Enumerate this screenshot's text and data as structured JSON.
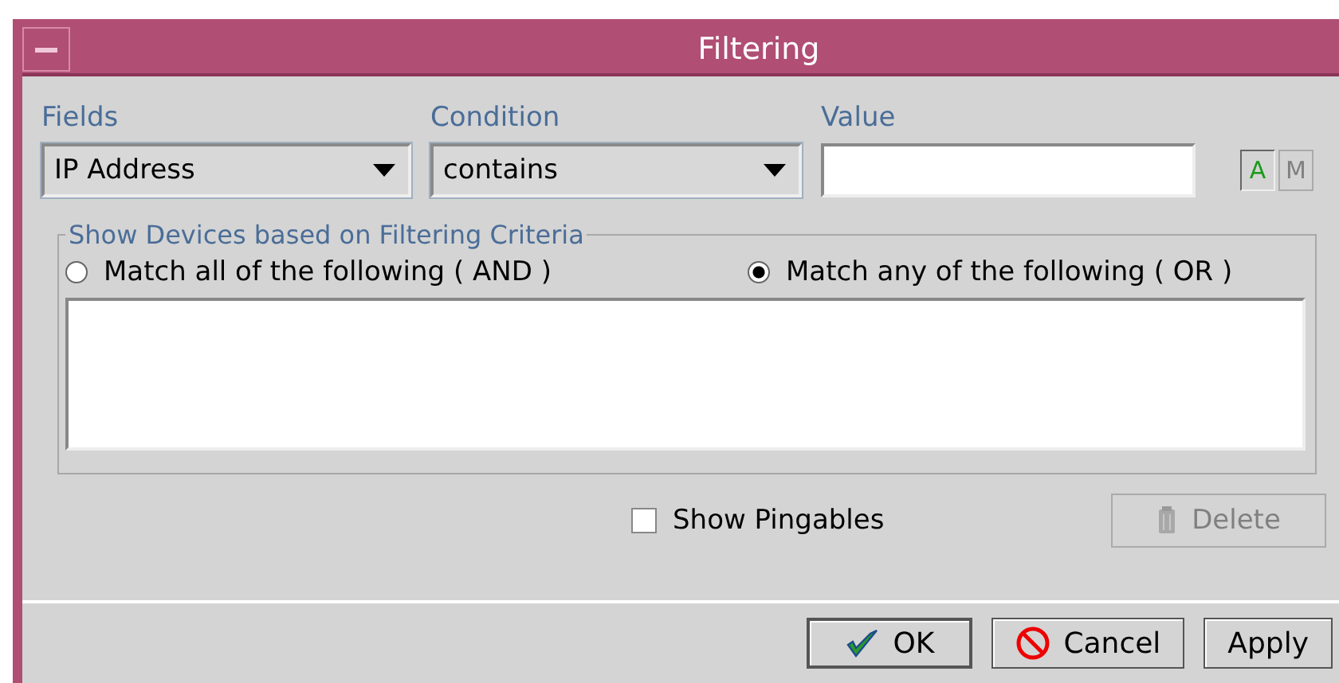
{
  "window": {
    "title": "Filtering"
  },
  "criteria": [
    {
      "kind": "select",
      "label": "Fields",
      "value": "IP Address"
    },
    {
      "kind": "select",
      "label": "Condition",
      "value": "contains"
    },
    {
      "kind": "input",
      "label": "Value"
    }
  ],
  "mode_buttons": [
    {
      "label": "A",
      "disabled": false
    },
    {
      "label": "M",
      "disabled": true
    }
  ],
  "group": {
    "legend": "Show Devices based on Filtering Criteria",
    "options": [
      {
        "label": "Match all of the following ( AND )",
        "selected": false
      },
      {
        "label": "Match any of the following ( OR )",
        "selected": true
      }
    ]
  },
  "show_pingables": {
    "label": "Show Pingables",
    "checked": false
  },
  "delete_button": {
    "label": "Delete",
    "disabled": true
  },
  "buttons": [
    {
      "kind": "ok",
      "label": "OK"
    },
    {
      "kind": "cancel",
      "label": "Cancel"
    },
    {
      "kind": "plain",
      "label": "Apply"
    }
  ]
}
